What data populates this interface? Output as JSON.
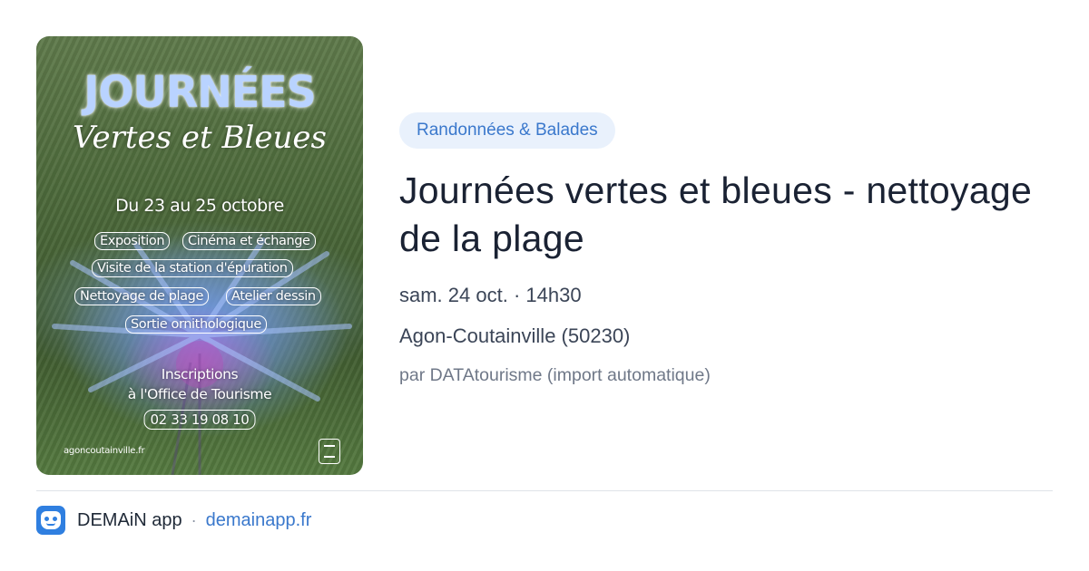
{
  "poster": {
    "title": "JOURNÉES",
    "subtitle": "Vertes et Bleues",
    "dates": "Du 23 au 25 octobre",
    "activities": [
      "Exposition",
      "Cinéma et échange",
      "Visite de la station d'épuration",
      "Nettoyage de plage",
      "Atelier dessin",
      "Sortie ornithologique"
    ],
    "inscriptions_line1": "Inscriptions",
    "inscriptions_line2": "à l'Office de Tourisme",
    "phone": "02 33 19 08 10",
    "website": "agoncoutainville.fr"
  },
  "event": {
    "category": "Randonnées & Balades",
    "title": "Journées vertes et bleues - nettoyage de la plage",
    "date_time": "sam. 24 oct. · 14h30",
    "location": "Agon-Coutainville (50230)",
    "author": "par DATAtourisme (import automatique)"
  },
  "footer": {
    "app_name": "DEMAiN app",
    "separator": "·",
    "domain": "demainapp.fr"
  },
  "colors": {
    "accent": "#3a78cc",
    "category_bg": "#e9f1fc",
    "app_icon": "#2f7fe0"
  }
}
